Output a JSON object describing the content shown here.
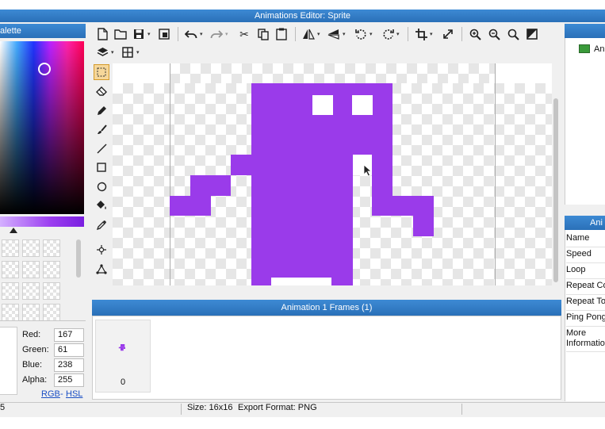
{
  "window": {
    "title": "Animations Editor: Sprite"
  },
  "palette": {
    "title": "alette",
    "color": {
      "red_label": "Red:",
      "red": "167",
      "green_label": "Green:",
      "green": "61",
      "blue_label": "Blue:",
      "blue": "238",
      "alpha_label": "Alpha:",
      "alpha": "255"
    },
    "mode_rgb": "RGB",
    "mode_sep": "-",
    "mode_hsl": "HSL"
  },
  "toolbar": {
    "icons": [
      "new-file-icon",
      "open-folder-icon",
      "save-icon",
      "save-as-icon",
      "undo-icon",
      "redo-icon",
      "cut-icon",
      "copy-icon",
      "paste-icon",
      "flip-horizontal-icon",
      "flip-vertical-icon",
      "rotate-left-icon",
      "rotate-right-icon",
      "crop-icon",
      "resize-icon",
      "zoom-in-icon",
      "zoom-out-icon",
      "zoom-reset-icon",
      "fit-icon",
      "layers-icon",
      "grid-icon"
    ]
  },
  "tools": [
    "selection-tool-icon",
    "eraser-icon",
    "pen-icon",
    "brush-icon",
    "line-icon",
    "rectangle-icon",
    "ellipse-icon",
    "fill-bucket-icon",
    "eyedropper-icon",
    "move-icon",
    "transform-icon"
  ],
  "sprite": {
    "color": "#9a3bea"
  },
  "frames": {
    "title": "Animation 1 Frames (1)",
    "items": [
      {
        "index": "0"
      }
    ]
  },
  "right_panel": {
    "list_item": "Ani",
    "title": "Ani",
    "properties": [
      "Name",
      "Speed",
      "Loop",
      "Repeat Co",
      "Repeat To",
      "Ping Pong",
      "More Information"
    ]
  },
  "status": {
    "left": "5",
    "size": "Size: 16x16",
    "format": "Export Format: PNG"
  },
  "colors": {
    "accent": "#2f78c4",
    "selected_tool": "#f6d79a"
  }
}
